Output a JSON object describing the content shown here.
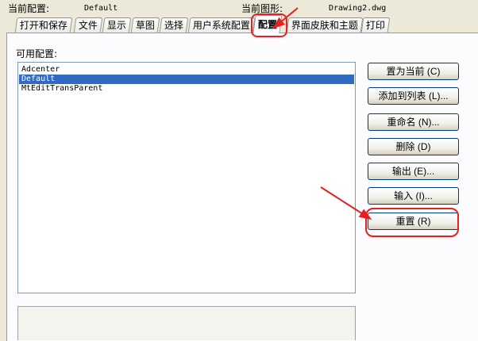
{
  "header": {
    "current_profile_label": "当前配置:",
    "current_profile_value": "Default",
    "current_drawing_label": "当前图形:",
    "current_drawing_value": "Drawing2.dwg"
  },
  "tabs": [
    {
      "label": "打开和保存"
    },
    {
      "label": "文件"
    },
    {
      "label": "显示"
    },
    {
      "label": "草图"
    },
    {
      "label": "选择"
    },
    {
      "label": "用户系统配置"
    },
    {
      "label": "配置",
      "active": true
    },
    {
      "label": "界面皮肤和主题"
    },
    {
      "label": "打印"
    }
  ],
  "profiles": {
    "label": "可用配置:",
    "items": [
      "Adcenter",
      "Default",
      "MtEditTransParent"
    ],
    "selected": "Default"
  },
  "buttons": {
    "set_current": "置为当前 (C)",
    "add_to_list": "添加到列表 (L)...",
    "rename": "重命名 (N)...",
    "delete": "删除 (D)",
    "export": "输出 (E)...",
    "import": "输入 (I)...",
    "reset": "重置 (R)"
  },
  "annotation_color": "#e52020"
}
